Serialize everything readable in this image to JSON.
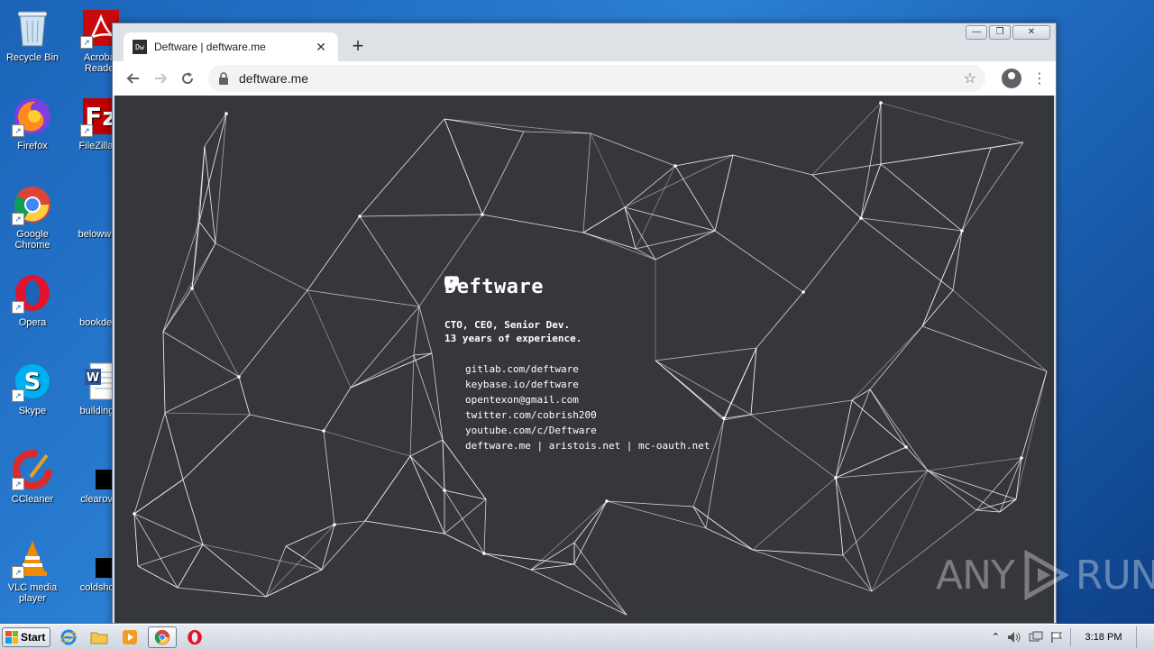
{
  "desktop": {
    "icons": [
      {
        "label": "Recycle Bin"
      },
      {
        "label": "Acrobat Reader"
      },
      {
        "label": "Firefox"
      },
      {
        "label": "FileZilla C"
      },
      {
        "label": "Google Chrome"
      },
      {
        "label": "belowwish"
      },
      {
        "label": "Opera"
      },
      {
        "label": "bookdetai"
      },
      {
        "label": "Skype"
      },
      {
        "label": "buildingtir"
      },
      {
        "label": "CCleaner"
      },
      {
        "label": "clearover"
      },
      {
        "label": "VLC media player"
      },
      {
        "label": "coldshoul"
      }
    ]
  },
  "browser": {
    "tab": {
      "favicon": "Dw",
      "title": "Deftware | deftware.me",
      "close": "✕"
    },
    "newtab": "+",
    "window_controls": {
      "minimize": "—",
      "restore": "❐",
      "close": "✕"
    },
    "address": {
      "url": "deftware.me"
    }
  },
  "page": {
    "heading": "Deftware",
    "tagline_1": "CTO, CEO, Senior Dev.",
    "tagline_2": "13 years of experience.",
    "links": [
      {
        "icon": "github-icon",
        "text": "gitlab.com/deftware"
      },
      {
        "icon": "key-icon",
        "text": "keybase.io/deftware"
      },
      {
        "icon": "mail-icon",
        "text": "opentexon@gmail.com"
      },
      {
        "icon": "twitter-icon",
        "text": "twitter.com/cobrish200"
      },
      {
        "icon": "youtube-icon",
        "text": "youtube.com/c/Deftware"
      },
      {
        "icon": "globe-icon",
        "text": "deftware.me | aristois.net | mc-oauth.net"
      }
    ]
  },
  "watermark": {
    "left": "ANY",
    "right": "RUN"
  },
  "taskbar": {
    "start_label": "Start",
    "clock": "3:18 PM"
  },
  "colors": {
    "page_background": "#36373c",
    "desktop_blue": "#2a7fd4",
    "network_lines": "#ffffff"
  }
}
